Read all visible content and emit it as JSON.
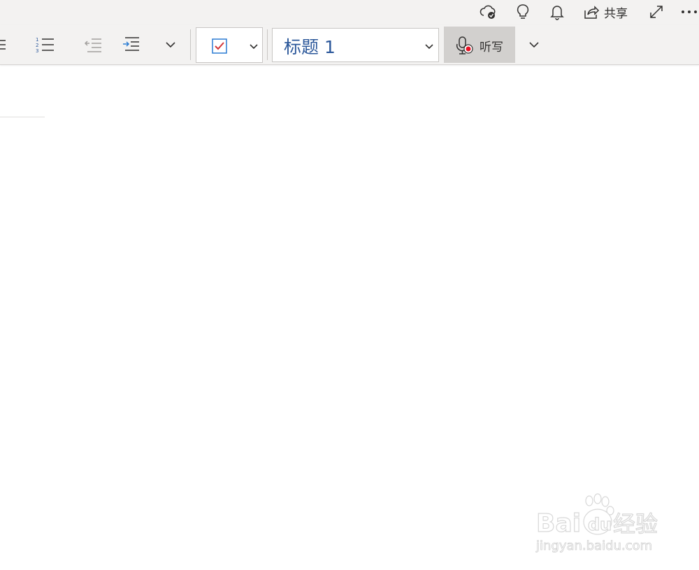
{
  "top_bar": {
    "share_label": "共享",
    "icons": [
      "cloud-sync-icon",
      "lightbulb-icon",
      "bell-icon",
      "share-icon",
      "expand-icon",
      "more-icon"
    ]
  },
  "ribbon": {
    "style_box": {
      "value": "标题 1"
    },
    "dictate": {
      "label": "听写"
    },
    "colors": {
      "accent_blue": "#2b579a",
      "record_red": "#e81123",
      "check_red": "#d13438"
    }
  },
  "watermark": {
    "brand_latin": "Bai",
    "brand_paw": "du",
    "brand_cn": "经验",
    "url": "jingyan.baidu.com"
  }
}
